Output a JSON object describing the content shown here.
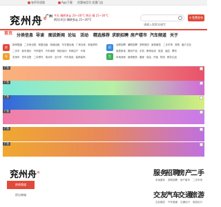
{
  "topbar": {
    "left_link": "有声早读版",
    "mid_link": "App下载",
    "right_link": "优惠电话号 优惠门店"
  },
  "header": {
    "logo": "兖州舟",
    "city": "广州",
    "weather_top": "今天  晴转多云 20~28°C  明天 晴 21~30°C",
    "weather_bottom": "明天(4日) 晴转多云 21~30°C",
    "search_placeholder": "请输入搜索关键字",
    "publish_label": "免费发布信息"
  },
  "nav": {
    "home": "首页",
    "items": [
      "分类信息",
      "导读",
      "图说新闻",
      "论坛",
      "活动",
      "精选推荐",
      "求职招聘",
      "房产楼市",
      "汽车频道",
      "关于"
    ]
  },
  "categories": {
    "left_icons": [
      {
        "label": "房",
        "color": "#e04a3a"
      },
      {
        "label": "车",
        "color": "#f0a030"
      }
    ],
    "left_rows": [
      [
        "新房楼盘",
        "二手房出售",
        "房屋出租",
        "商铺出租",
        "写字楼出租",
        "厂房仓库",
        "求租求购"
      ],
      [
        "二手车",
        "新车报价",
        "汽车配件",
        "汽车维修",
        "驾校培训",
        "车辆过户",
        "代驾"
      ],
      [
        "农用车",
        "货车出售",
        "二手摩托",
        "电动车",
        "自行车",
        "汽车用品",
        "装修装饰"
      ]
    ],
    "right_icons": [
      {
        "label": "招",
        "color": "#3a8ae0"
      },
      {
        "label": "生",
        "color": "#40b060"
      }
    ],
    "right_rows": [
      [
        "全职招聘",
        "兼职招聘",
        "求职简历",
        "家政服务",
        "二手市场",
        "宠物",
        "婚介交友"
      ],
      [
        "家居家电",
        "数码产品",
        "手机",
        "教育培训",
        "旅游",
        "酒店",
        "票务"
      ],
      [
        "本地商家",
        "维修服务",
        "搬家",
        "保洁",
        "开锁",
        "物流",
        "鲜花礼品"
      ]
    ]
  },
  "banners": {
    "tag": "广告"
  },
  "footer": {
    "logo": "兖州舟",
    "active_tab": "热线频道",
    "tab2": "积分商城",
    "columns": [
      {
        "big": "服务",
        "small": "本地服务"
      },
      {
        "big": "招聘",
        "small": "求职招聘"
      },
      {
        "big": "房产",
        "small": "房产楼市"
      },
      {
        "big": "二手",
        "small": "二手市场"
      },
      {
        "big": "交友",
        "small": "交友婚恋"
      },
      {
        "big": "汽车",
        "small": "汽车频道"
      },
      {
        "big": "交通",
        "small": "交通出行"
      },
      {
        "big": "旅游",
        "small": "旅游出行"
      }
    ]
  },
  "colors": {
    "brand": "#e04a3a"
  }
}
